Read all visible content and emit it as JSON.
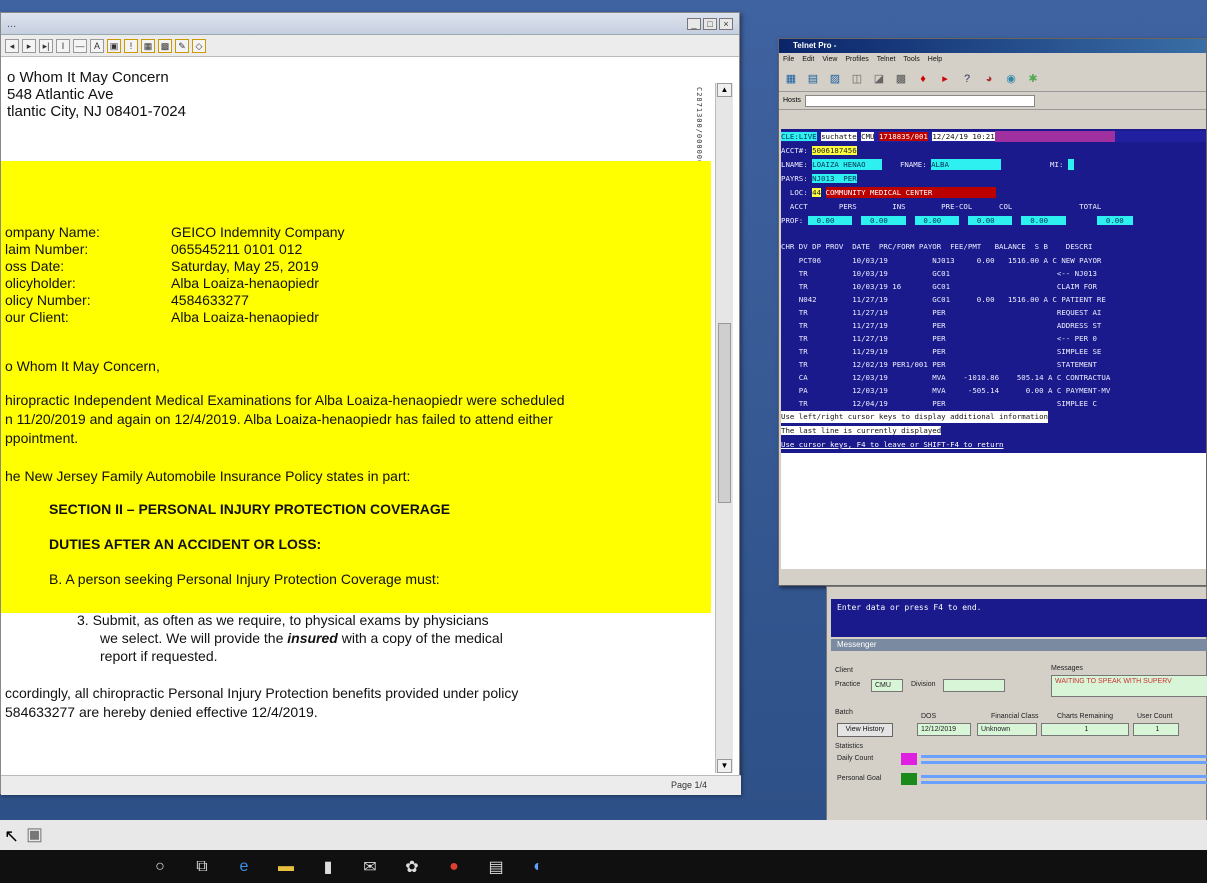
{
  "doc": {
    "title_blur": "...",
    "address": [
      "o Whom It May Concern",
      "548 Atlantic Ave",
      "tlantic City, NJ 08401-7024"
    ],
    "fields": [
      {
        "label": "ompany Name:",
        "value": "GEICO Indemnity Company"
      },
      {
        "label": "laim Number:",
        "value": "065545211 0101 012"
      },
      {
        "label": "oss Date:",
        "value": "Saturday, May 25, 2019"
      },
      {
        "label": "olicyholder:",
        "value": "Alba Loaiza-henaopiedr"
      },
      {
        "label": "olicy Number:",
        "value": "4584633277"
      },
      {
        "label": "our Client:",
        "value": "Alba Loaiza-henaopiedr"
      }
    ],
    "salutation": "o Whom It May Concern,",
    "para1_l1": "hiropractic Independent Medical Examinations for Alba Loaiza-henaopiedr were scheduled",
    "para1_l2": "n 11/20/2019 and again on 12/4/2019. Alba Loaiza-henaopiedr has failed to attend either",
    "para1_l3": "ppointment.",
    "para2": "he New Jersey Family Automobile Insurance Policy states in part:",
    "section": "SECTION II – PERSONAL INJURY PROTECTION COVERAGE",
    "duties": "DUTIES AFTER AN ACCIDENT OR LOSS:",
    "itemB": "B.  A person seeking Personal Injury Protection Coverage must:",
    "item3_l1": "3.  Submit, as often as we require, to physical exams by physicians",
    "item3_l2": "we select. We will provide the",
    "item3_insured": "insured",
    "item3_l2b": "with a copy of the medical",
    "item3_l3": "report if requested.",
    "para3_l1": "ccordingly, all chiropractic Personal Injury Protection benefits provided under policy",
    "para3_l2": "584633277 are hereby denied effective 12/4/2019.",
    "page": "Page 1/4"
  },
  "telnet": {
    "title": "Telnet Pro - ",
    "menu": [
      "File",
      "Edit",
      "View",
      "Profiles",
      "Telnet",
      "Tools",
      "Help"
    ],
    "host_label": "Hosts",
    "status": "CLE:LIVE",
    "user": "suchatte",
    "prac": "CMU",
    "acct_code": "1718835/001",
    "datetime": "12/24/19 10:21",
    "acct_no": "5006187456",
    "lname": "LOAIZA HENAO",
    "fname": "ALBA",
    "payrs": "NJ013  PER",
    "loc_code": "44",
    "loc": "COMMUNITY MEDICAL CENTER",
    "col_hdrs": "  ACCT       PERS        INS        PRE-COL      COL               TOTAL",
    "list_hdr": "CHR DV DP PROV  DATE  PRC/FORM PAYOR  FEE/PMT   BALANCE  S B    DESCRI",
    "rows": [
      "    PCT06       10/03/19          NJ013     0.00   1516.00 A C NEW PAYOR",
      "    TR          10/03/19          GC01                        <-- NJ013",
      "    TR          10/03/19 16       GC01                        CLAIM FOR",
      "    N042        11/27/19          GC01      0.00   1516.00 A C PATIENT RE",
      "    TR          11/27/19          PER                         REQUEST AI",
      "    TR          11/27/19          PER                         ADDRESS ST",
      "    TR          11/27/19          PER                         <-- PER 0",
      "    TR          11/29/19          PER                         SIMPLEE SE",
      "    TR          12/02/19 PER1/001 PER                         STATEMENT",
      "    CA          12/03/19          MVA    -1010.86    505.14 A C CONTRACTUA",
      "    PA          12/03/19          MVA     -505.14      0.00 A C PAYMENT-MV",
      "    TR          12/04/19          PER                         SIMPLEE C"
    ],
    "msg1": "Use left/right cursor keys to display additional information",
    "msg2": "The last line is currently displayed",
    "msg3": "Use cursor keys, F4 to leave or SHIFT-F4 to return"
  },
  "lower": {
    "enter": "Enter data or press F4 to end.",
    "msg_title": "Messenger",
    "client_label": "Client",
    "practice_label": "Practice",
    "practice_val": "CMU",
    "division_label": "Division",
    "messages_label": "Messages",
    "messages_val": "WAITING TO SPEAK WITH SUPERV",
    "batch_label": "Batch",
    "dos_label": "DOS",
    "fin_label": "Financial Class",
    "charts_label": "Charts Remaining",
    "user_label": "User Count",
    "view_btn": "View History",
    "dos_val": "12/12/2019",
    "fin_val": "Unknown",
    "charts_val": "1",
    "user_val": "1",
    "stats_label": "Statistics",
    "daily_label": "Daily Count",
    "goal_label": "Personal Goal"
  },
  "taskbar": {
    "icons": [
      "start-circle-icon",
      "task-view-icon",
      "edge-icon",
      "explorer-icon",
      "store-icon",
      "mail-icon",
      "settings-icon",
      "chrome-icon",
      "notes-icon",
      "app-icon"
    ]
  },
  "colors": {
    "highlight": "#ffff00",
    "terminal_bg": "#1a1a8c",
    "cyan_field": "#2ef0f0"
  }
}
